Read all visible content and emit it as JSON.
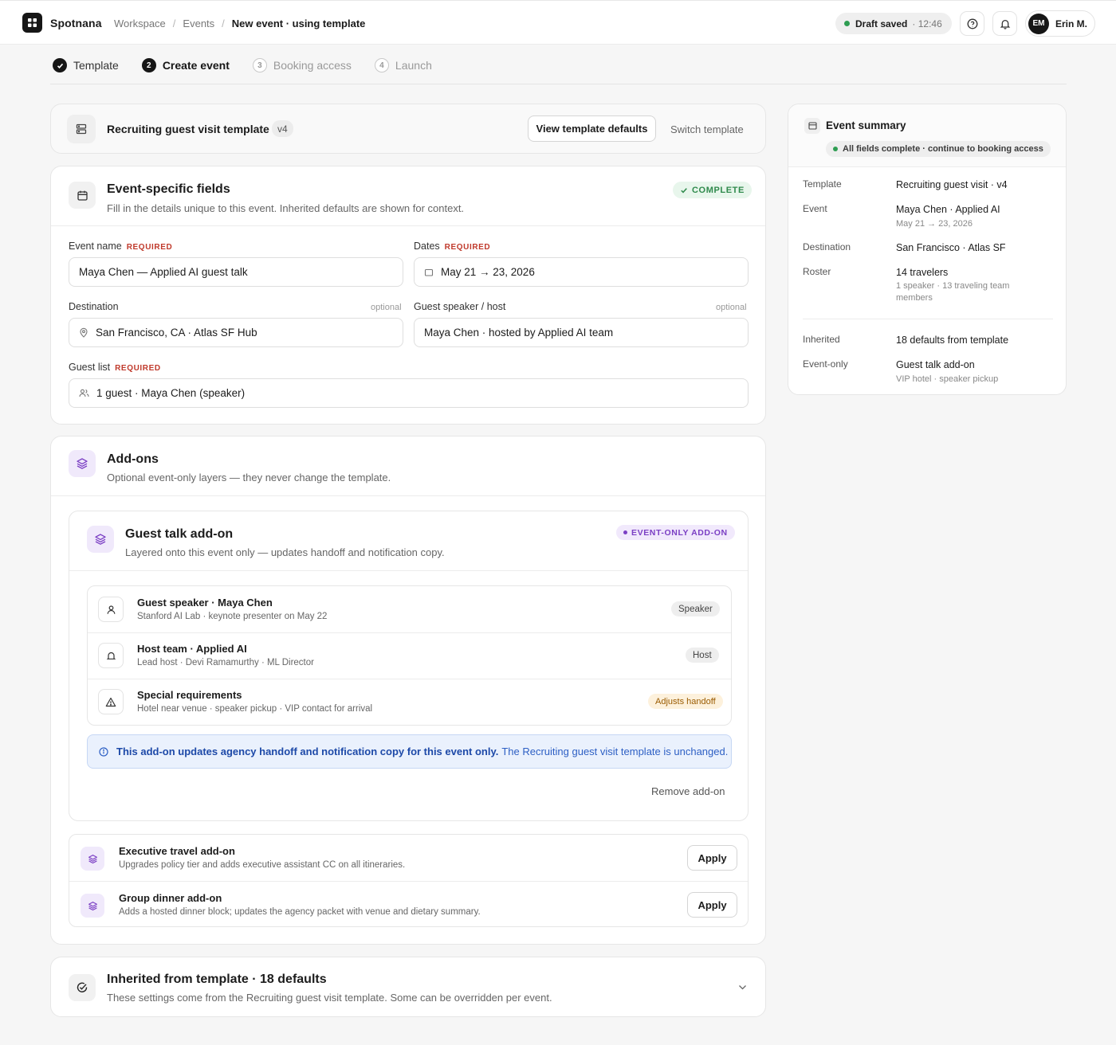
{
  "app": {
    "brand": "Spotnana",
    "breadcrumbs": [
      "Workspace",
      "Events",
      "New event · using template"
    ]
  },
  "status": {
    "draft": "Draft saved",
    "time": "12:46"
  },
  "user": {
    "initials": "EM",
    "name": "Erin M."
  },
  "steps": [
    {
      "num": "✓",
      "label": "Template"
    },
    {
      "num": "2",
      "label": "Create event"
    },
    {
      "num": "3",
      "label": "Booking access"
    },
    {
      "num": "4",
      "label": "Launch"
    }
  ],
  "template": {
    "name": "Recruiting guest visit template",
    "version": "v4",
    "view_label": "View template defaults",
    "switch_label": "Switch template"
  },
  "fields": {
    "title": "Event-specific fields",
    "subtitle": "Fill in the details unique to this event. Inherited defaults are shown for context.",
    "status": "COMPLETE",
    "required_tag": "REQUIRED",
    "optional_tag": "optional",
    "event_name": {
      "label": "Event name",
      "value": "Maya Chen — Applied AI guest talk"
    },
    "dates": {
      "label": "Dates",
      "value": "May 21 → 23, 2026"
    },
    "destination": {
      "label": "Destination",
      "value": "San Francisco, CA · Atlas SF Hub"
    },
    "speaker": {
      "label": "Guest speaker / host",
      "value": "Maya Chen · hosted by Applied AI team"
    },
    "guests": {
      "label": "Guest list",
      "value": "1 guest · Maya Chen (speaker)"
    }
  },
  "addons": {
    "title": "Add-ons",
    "subtitle": "Optional event-only layers — they never change the template.",
    "guest_talk": {
      "title": "Guest talk add-on",
      "subtitle": "Layered onto this event only — updates handoff and notification copy.",
      "badge": "EVENT-ONLY ADD-ON",
      "rows": [
        {
          "title": "Guest speaker · Maya Chen",
          "sub": "Stanford AI Lab · keynote presenter on May 22",
          "chip": "Speaker"
        },
        {
          "title": "Host team · Applied AI",
          "sub": "Lead host · Devi Ramamurthy · ML Director",
          "chip": "Host"
        },
        {
          "title": "Special requirements",
          "sub": "Hotel near venue · speaker pickup · VIP contact for arrival",
          "chip": "Adjusts handoff"
        }
      ],
      "info_bold": "This add-on updates agency handoff and notification copy for this event only.",
      "info_rest": "The Recruiting guest visit template is unchanged.",
      "remove_label": "Remove add-on"
    },
    "others": [
      {
        "title": "Executive travel add-on",
        "sub": "Upgrades policy tier and adds executive assistant CC on all itineraries.",
        "action": "Apply"
      },
      {
        "title": "Group dinner add-on",
        "sub": "Adds a hosted dinner block; updates the agency packet with venue and dietary summary.",
        "action": "Apply"
      }
    ]
  },
  "inherited": {
    "title": "Inherited from template · 18 defaults",
    "subtitle": "These settings come from the Recruiting guest visit template. Some can be overridden per event."
  },
  "summary": {
    "title": "Event summary",
    "badge": "All fields complete · continue to booking access",
    "items": [
      {
        "key": "Template",
        "value": "Recruiting guest visit · v4",
        "sub": ""
      },
      {
        "key": "Event",
        "value": "Maya Chen · Applied AI",
        "sub": "May 21 → 23, 2026"
      },
      {
        "key": "Destination",
        "value": "San Francisco · Atlas SF",
        "sub": ""
      },
      {
        "key": "Roster",
        "value": "14 travelers",
        "sub": "1 speaker · 13 traveling team members"
      },
      {
        "key": "Inherited",
        "value": "18 defaults from template",
        "sub": ""
      },
      {
        "key": "Event-only",
        "value": "Guest talk add-on",
        "sub": "VIP hotel · speaker pickup"
      }
    ]
  },
  "colors": {
    "accent_dark": "#161616",
    "success": "#2e9d52",
    "required": "#c0392b",
    "addon_purple": "#7b3fc4",
    "info_blue": "#2d5fc4"
  },
  "icons": {
    "logo": "grid-icon",
    "help": "help-icon",
    "bell": "bell-icon",
    "template": "server-icon",
    "fields": "calendar-icon",
    "addons": "layers-icon",
    "speaker": "user-icon",
    "host": "bell-icon",
    "requirements": "warning-icon",
    "info": "info-icon",
    "inherited": "check-circle-icon",
    "chevron": "chevron-down-icon"
  }
}
